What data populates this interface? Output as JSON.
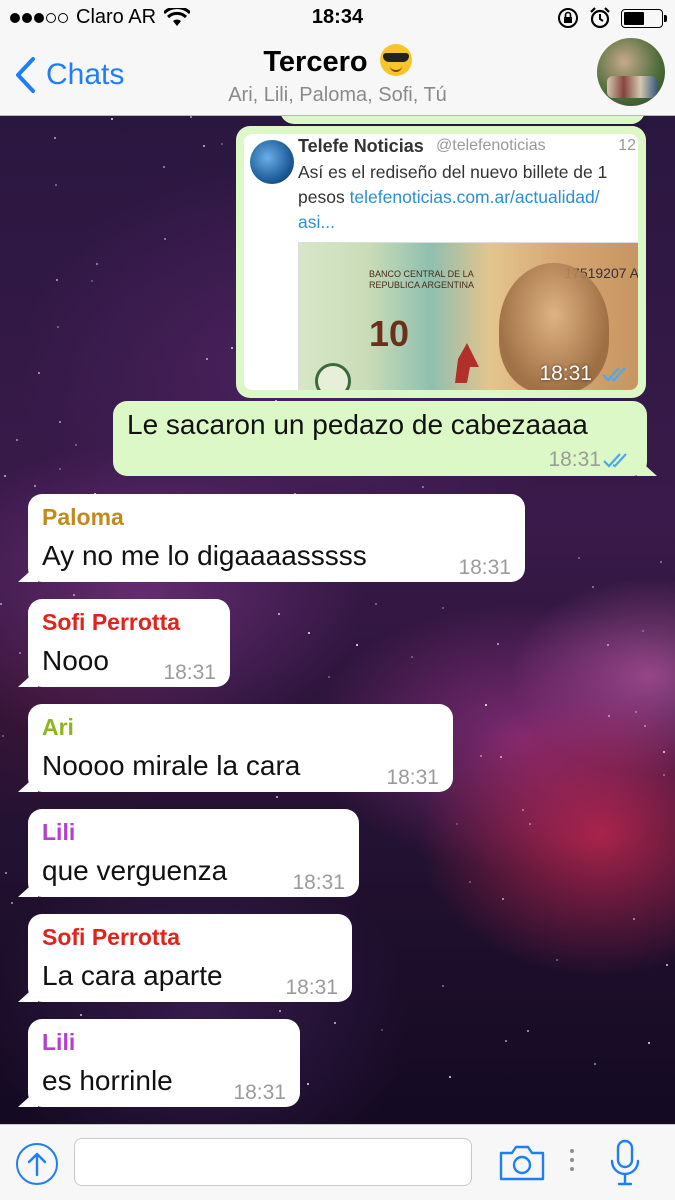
{
  "status_bar": {
    "carrier": "Claro AR",
    "time": "18:34",
    "icons": [
      "signal-dots",
      "wifi-icon",
      "rotation-lock-icon",
      "alarm-icon",
      "battery-icon"
    ]
  },
  "header": {
    "back_label": "Chats",
    "title": "Tercero",
    "title_emoji": "sunglasses-emoji",
    "members": "Ari, Lili, Paloma, Sofi, Tú"
  },
  "link_preview": {
    "account_name": "Telefe Noticias",
    "handle": "@telefenoticias",
    "counter": "12",
    "text_line1": "Así es el rediseño del nuevo billete de 1",
    "text_line2_prefix": "pesos ",
    "link_part1": "telefenoticias.com.ar/actualidad/",
    "link_part2": "asi...",
    "image_bank_text": "BANCO CENTRAL DE LA REPUBLICA ARGENTINA",
    "image_serial": "17519207 A",
    "image_denomination": "10",
    "time": "18:31"
  },
  "messages": [
    {
      "direction": "out",
      "text": "Le sacaron un pedazo de cabezaaaa",
      "time": "18:31",
      "read": true
    },
    {
      "direction": "in",
      "sender": "Paloma",
      "sender_color": "#c08b1c",
      "text": "Ay no me lo digaaaasssss",
      "time": "18:31"
    },
    {
      "direction": "in",
      "sender": "Sofi Perrotta",
      "sender_color": "#e0231b",
      "text": "Nooo",
      "time": "18:31"
    },
    {
      "direction": "in",
      "sender": "Ari",
      "sender_color": "#8fb51d",
      "text": "Noooo mirale la cara",
      "time": "18:31"
    },
    {
      "direction": "in",
      "sender": "Lili",
      "sender_color": "#b23fcf",
      "text": "que verguenza",
      "time": "18:31"
    },
    {
      "direction": "in",
      "sender": "Sofi Perrotta",
      "sender_color": "#e0231b",
      "text": "La cara aparte",
      "time": "18:31"
    },
    {
      "direction": "in",
      "sender": "Lili",
      "sender_color": "#b23fcf",
      "text": "es horrinle",
      "time": "18:31"
    }
  ],
  "input_bar": {
    "placeholder": "",
    "icons": [
      "attach-icon",
      "camera-icon",
      "more-dots-icon",
      "microphone-icon"
    ]
  },
  "colors": {
    "accent": "#1e7ef6",
    "outgoing_bubble": "#dcf8c6",
    "incoming_bubble": "#ffffff",
    "read_checks": "#4fa6f0"
  }
}
